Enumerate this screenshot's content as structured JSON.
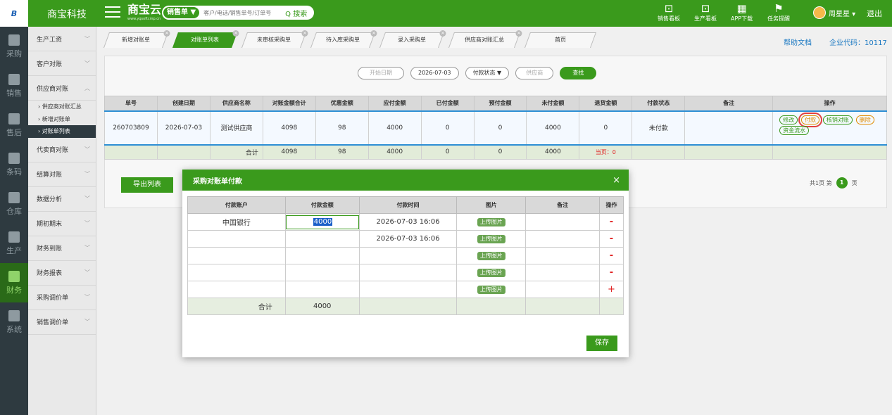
{
  "header": {
    "logo_text": "B",
    "company": "商宝科技",
    "brand": "商宝云",
    "brand_url": "www.yqsoftcmp.cn",
    "search_type": "销售单 ▼",
    "search_placeholder": "客户/电话/销售单号/订单号",
    "search_button": "Q 搜索",
    "icons": [
      {
        "label": "销售看板",
        "icon": "chart-icon"
      },
      {
        "label": "生产看板",
        "icon": "chart-icon"
      },
      {
        "label": "APP下载",
        "icon": "qr-icon"
      },
      {
        "label": "任务提醒",
        "icon": "flag-icon"
      }
    ],
    "user": "周星星 ▾",
    "logout": "退出"
  },
  "iconbar": [
    {
      "label": "采购",
      "active": false
    },
    {
      "label": "销售",
      "active": false
    },
    {
      "label": "售后",
      "active": false
    },
    {
      "label": "条码",
      "active": false
    },
    {
      "label": "仓库",
      "active": false
    },
    {
      "label": "生产",
      "active": false
    },
    {
      "label": "财务",
      "active": true
    },
    {
      "label": "系统",
      "active": false
    }
  ],
  "submenu": {
    "items": [
      "生产工资",
      "客户对账",
      "供应商对账"
    ],
    "sub_items": [
      "› 供应商对账汇总",
      "› 新增对账单",
      "› 对账单列表"
    ],
    "items_after": [
      "代卖商对账",
      "结算对账",
      "数据分析",
      "期初期末",
      "财务到账",
      "财务报表",
      "采购调价单",
      "销售调价单"
    ]
  },
  "tabs": [
    "新增对账单",
    "对账单列表",
    "未审核采购单",
    "待入库采购单",
    "录入采购单",
    "供应商对账汇总",
    "首页"
  ],
  "topright": {
    "help": "帮助文档",
    "corp": "企业代码：10117"
  },
  "filters": {
    "start_date": "开始日期",
    "end_date": "2026-07-03",
    "status": "付款状态  ▼",
    "supplier": "供应商",
    "search": "查找"
  },
  "main_table": {
    "headers": [
      "单号",
      "创建日期",
      "供应商名称",
      "对账金额合计",
      "优惠金额",
      "应付金额",
      "已付金额",
      "预付金额",
      "未付金额",
      "退货金额",
      "付款状态",
      "备注",
      "操作"
    ],
    "row": [
      "260703809",
      "2026-07-03",
      "测试供应商",
      "4098",
      "98",
      "4000",
      "0",
      "0",
      "4000",
      "0",
      "未付款",
      ""
    ],
    "ops": [
      "修改",
      "付款",
      "核销对账",
      "删除",
      "资金流水"
    ],
    "total_label": "合计",
    "totals": [
      "4098",
      "98",
      "4000",
      "0",
      "0",
      "4000"
    ],
    "today_returns": "当页：0"
  },
  "export_button": "导出列表",
  "pager": {
    "total": "共1页  第",
    "page": "1",
    "suffix": "页"
  },
  "modal": {
    "title": "采购对账单付款",
    "close": "×",
    "headers": [
      "付款账户",
      "付款金额",
      "付款时间",
      "图片",
      "备注",
      "操作"
    ],
    "rows": [
      {
        "account": "中国银行",
        "amount": "4000",
        "time": "2026-07-03 16:06",
        "upload": "上传图片",
        "note": "",
        "op": "-"
      },
      {
        "account": "",
        "amount": "",
        "time": "2026-07-03 16:06",
        "upload": "上传图片",
        "note": "",
        "op": "-"
      },
      {
        "account": "",
        "amount": "",
        "time": "",
        "upload": "上传图片",
        "note": "",
        "op": "-"
      },
      {
        "account": "",
        "amount": "",
        "time": "",
        "upload": "上传图片",
        "note": "",
        "op": "-"
      },
      {
        "account": "",
        "amount": "",
        "time": "",
        "upload": "上传图片",
        "note": "",
        "op": "+"
      }
    ],
    "total_label": "合计",
    "total": "4000",
    "save": "保存"
  }
}
